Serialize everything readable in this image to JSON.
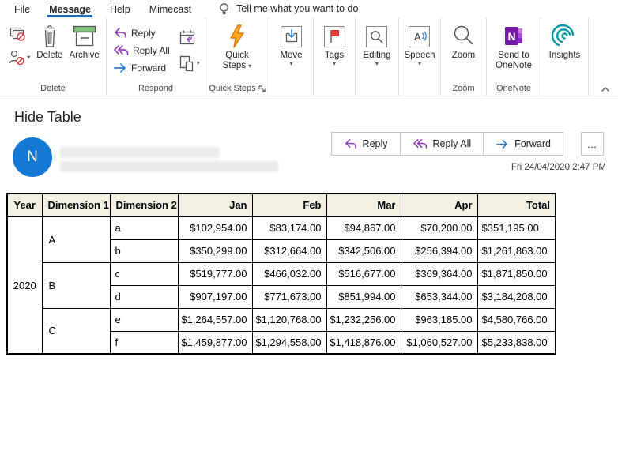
{
  "tabs": {
    "file": "File",
    "message": "Message",
    "help": "Help",
    "mimecast": "Mimecast"
  },
  "tellme": {
    "label": "Tell me what you want to do"
  },
  "ui": {
    "caret": "▾",
    "more": "…"
  },
  "ribbon": {
    "groups": {
      "delete": {
        "label": "Delete",
        "buttons": {
          "delete": "Delete",
          "archive": "Archive"
        }
      },
      "respond": {
        "label": "Respond",
        "buttons": {
          "reply": "Reply",
          "reply_all": "Reply All",
          "forward": "Forward"
        }
      },
      "quick_steps": {
        "label": "Quick Steps",
        "buttons": {
          "quick_steps": "Quick Steps"
        }
      },
      "move": {
        "buttons": {
          "move": "Move"
        }
      },
      "tags": {
        "buttons": {
          "tags": "Tags"
        }
      },
      "editing": {
        "buttons": {
          "editing": "Editing"
        }
      },
      "speech": {
        "buttons": {
          "speech": "Speech"
        }
      },
      "zoom": {
        "label": "Zoom",
        "buttons": {
          "zoom": "Zoom"
        }
      },
      "onenote": {
        "label": "OneNote",
        "buttons": {
          "send_to_onenote": "Send to OneNote"
        }
      },
      "insights": {
        "buttons": {
          "insights": "Insights"
        }
      }
    }
  },
  "message": {
    "subject": "Hide Table",
    "sender_initial": "N",
    "received": "Fri 24/04/2020 2:47 PM",
    "actions": {
      "reply": "Reply",
      "reply_all": "Reply All",
      "forward": "Forward"
    }
  },
  "table": {
    "headers": [
      "Year",
      "Dimension 1",
      "Dimension 2",
      "Jan",
      "Feb",
      "Mar",
      "Apr",
      "Total"
    ],
    "year": "2020",
    "rows": [
      {
        "dim1": "A",
        "dim2": "a",
        "jan": "$102,954.00",
        "feb": "$83,174.00",
        "mar": "$94,867.00",
        "apr": "$70,200.00",
        "total": "$351,195.00"
      },
      {
        "dim2": "b",
        "jan": "$350,299.00",
        "feb": "$312,664.00",
        "mar": "$342,506.00",
        "apr": "$256,394.00",
        "total": "$1,261,863.00"
      },
      {
        "dim1": "B",
        "dim2": "c",
        "jan": "$519,777.00",
        "feb": "$466,032.00",
        "mar": "$516,677.00",
        "apr": "$369,364.00",
        "total": "$1,871,850.00"
      },
      {
        "dim2": "d",
        "jan": "$907,197.00",
        "feb": "$771,673.00",
        "mar": "$851,994.00",
        "apr": "$653,344.00",
        "total": "$3,184,208.00"
      },
      {
        "dim1": "C",
        "dim2": "e",
        "jan": "$1,264,557.00",
        "feb": "$1,120,768.00",
        "mar": "$1,232,256.00",
        "apr": "$963,185.00",
        "total": "$4,580,766.00"
      },
      {
        "dim2": "f",
        "jan": "$1,459,877.00",
        "feb": "$1,294,558.00",
        "mar": "$1,418,876.00",
        "apr": "$1,060,527.00",
        "total": "$5,233,838.00"
      }
    ]
  },
  "colors": {
    "accent_blue": "#1f6bbd",
    "avatar_blue": "#1377d4",
    "table_header_bg": "#f2f0e3",
    "reply_purple": "#9440bf",
    "forward_blue": "#2b7cd3",
    "flag_red": "#e83c3c",
    "bolt_orange": "#ffa91f",
    "archive_green": "#7dc47a",
    "onenote_purple": "#7719aa",
    "insights_teal": "#0097a0"
  }
}
